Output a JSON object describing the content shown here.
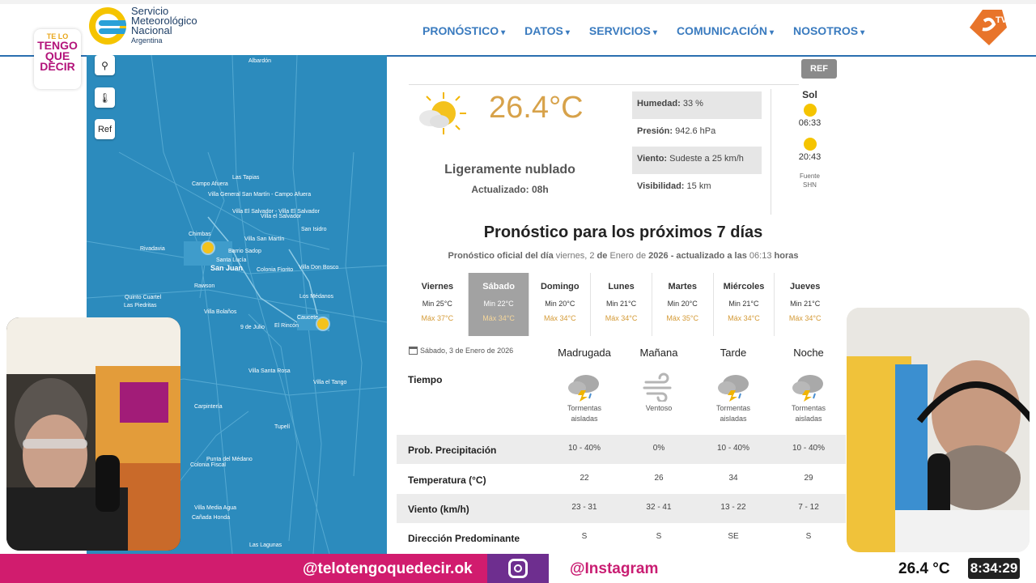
{
  "header": {
    "logo": {
      "line1": "Servicio",
      "line2": "Meteorológico",
      "line3": "Nacional",
      "line4": "Argentina"
    },
    "nav": [
      "PRONÓSTICO",
      "DATOS",
      "SERVICIOS",
      "COMUNICACIÓN",
      "NOSOTROS"
    ],
    "caret": "▾",
    "tv_badge": "TV"
  },
  "show_logo": {
    "l1": "TE LO",
    "l2": "TENGO",
    "l3": "QUE",
    "l4": "DECIR"
  },
  "map": {
    "buttons": {
      "location": "⚲",
      "thermo": "🌡",
      "ref": "Ref"
    },
    "labels": [
      "Las Tapias",
      "Campo Afuera",
      "Villa General San Martín - Campo Afuera",
      "Villa El Salvador - Villa El Salvador",
      "Villa el Salvador",
      "Chimbas",
      "Villa San Martín",
      "San Isidro",
      "Barrio Sadop",
      "Rivadavia",
      "Santa Lucía",
      "San Juan",
      "Colonia Fiorito",
      "Villa Don Bosco",
      "Rawson",
      "Los Médanos",
      "Quinto Cuartel",
      "Las Piedritas",
      "Villa Bolaños",
      "Caucete",
      "9 de Julio",
      "El Rincón",
      "Villa Santa Rosa",
      "Villa el Tango",
      "Carpintería",
      "Tupelí",
      "Punta del Médano",
      "Colonia Fiscal",
      "Villa Media Agua",
      "Cañada Honda",
      "Las Lagunas",
      "Albardón"
    ]
  },
  "current": {
    "ref_button": "REF",
    "temperature": "26.4°C",
    "condition": "Ligeramente nublado",
    "updated": "Actualizado: 08h",
    "stats": [
      {
        "label": "Humedad:",
        "value": "33 %"
      },
      {
        "label": "Presión:",
        "value": "942.6 hPa"
      },
      {
        "label": "Viento:",
        "value": "Sudeste a 25 km/h"
      },
      {
        "label": "Visibilidad:",
        "value": "15 km"
      }
    ],
    "sun": {
      "title": "Sol",
      "sunrise": "06:33",
      "sunset": "20:43",
      "source1": "Fuente",
      "source2": "SHN"
    }
  },
  "forecast": {
    "title": "Pronóstico para los próximos 7 días",
    "subtitle": {
      "p1": "Pronóstico oficial del día",
      "p2": "viernes, 2",
      "p3": "de",
      "p4": "Enero de",
      "p5": "2026",
      "p6": "- actualizado a las",
      "p7": "06:13",
      "p8": "horas"
    },
    "days": [
      {
        "name": "Viernes",
        "min": "Min 25°C",
        "max": "Máx 37°C"
      },
      {
        "name": "Sábado",
        "min": "Min 22°C",
        "max": "Máx 34°C"
      },
      {
        "name": "Domingo",
        "min": "Min 20°C",
        "max": "Máx 34°C"
      },
      {
        "name": "Lunes",
        "min": "Min 21°C",
        "max": "Máx 34°C"
      },
      {
        "name": "Martes",
        "min": "Min 20°C",
        "max": "Máx 35°C"
      },
      {
        "name": "Miércoles",
        "min": "Min 21°C",
        "max": "Máx 34°C"
      },
      {
        "name": "Jueves",
        "min": "Min 21°C",
        "max": "Máx 34°C"
      }
    ],
    "selected_day": "Sábado"
  },
  "detail": {
    "date": "Sábado, 3 de Enero de 2026",
    "periods": [
      "Madrugada",
      "Mañana",
      "Tarde",
      "Noche"
    ],
    "row_weather": "Tiempo",
    "weather": [
      {
        "icon": "storm-cloud-icon",
        "desc1": "Tormentas",
        "desc2": "aisladas"
      },
      {
        "icon": "wind-icon",
        "desc1": "Ventoso",
        "desc2": ""
      },
      {
        "icon": "storm-cloud-icon",
        "desc1": "Tormentas",
        "desc2": "aisladas"
      },
      {
        "icon": "storm-cloud-icon",
        "desc1": "Tormentas",
        "desc2": "aisladas"
      }
    ],
    "rows": [
      {
        "label": "Prob. Precipitación",
        "values": [
          "10 - 40%",
          "0%",
          "10 - 40%",
          "10 - 40%"
        ]
      },
      {
        "label": "Temperatura (°C)",
        "values": [
          "22",
          "26",
          "34",
          "29"
        ]
      },
      {
        "label": "Viento (km/h)",
        "values": [
          "23 - 31",
          "32 - 41",
          "13 - 22",
          "7 - 12"
        ]
      },
      {
        "label": "Dirección Predominante",
        "values": [
          "S",
          "S",
          "SE",
          "S"
        ]
      }
    ]
  },
  "overlay": {
    "handle": "@telotengoquedecir.ok",
    "instagram": "@Instagram",
    "temp": "26.4 °C",
    "clock": "8:34:29"
  },
  "colors": {
    "accent": "#3a7bbf",
    "pink": "#d11c6e",
    "purple": "#6e2e8f",
    "temp_orange": "#d7a24a"
  }
}
